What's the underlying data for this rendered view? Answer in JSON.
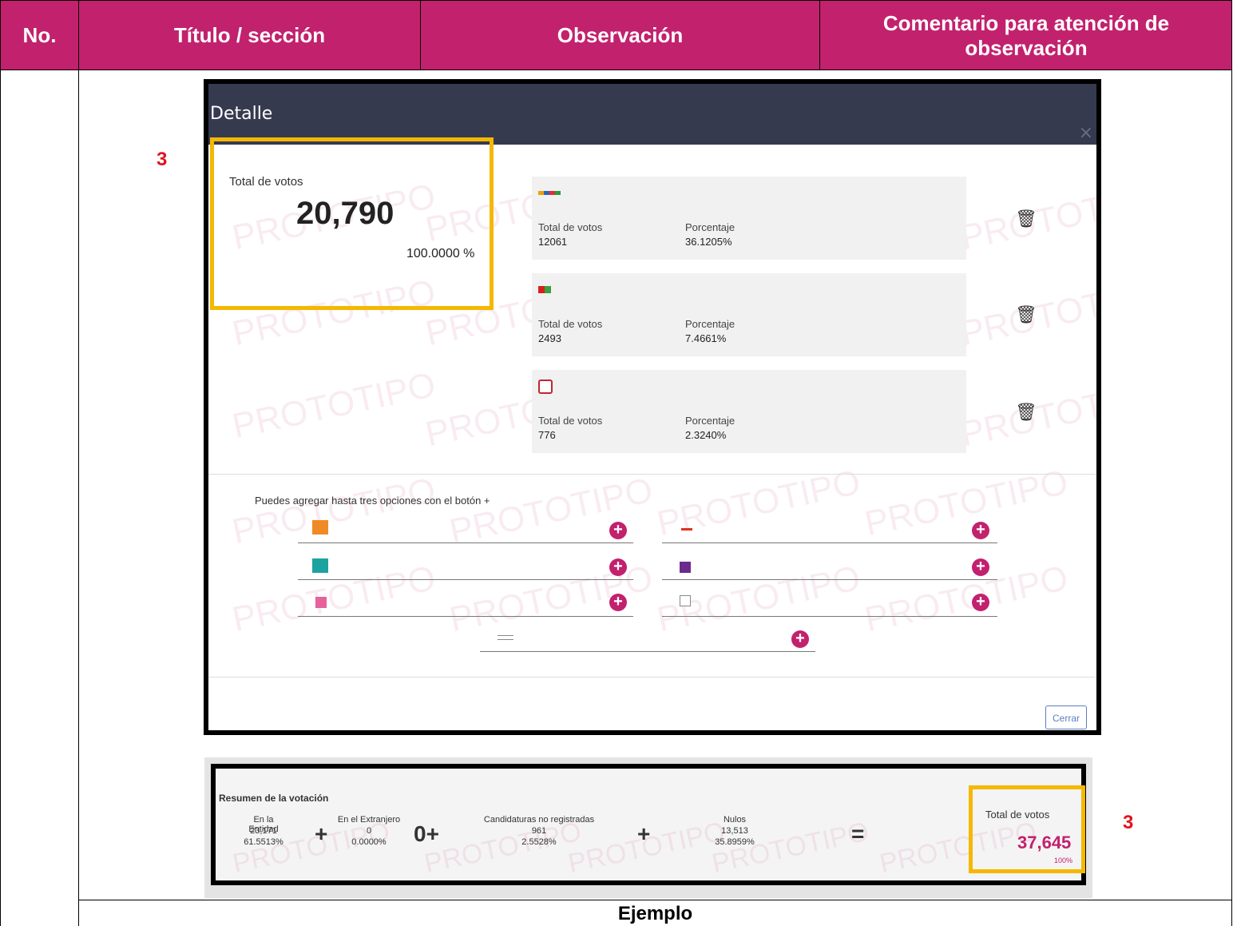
{
  "header": {
    "col_no": "No.",
    "col_titulo": "Título / sección",
    "col_observacion": "Observación",
    "col_comentario": "Comentario para atención de observación"
  },
  "annotations": {
    "marker_1": "3",
    "marker_2": "3"
  },
  "modal": {
    "title": "Detalle",
    "close": "×",
    "total_label": "Total de votos",
    "total_value": "20,790",
    "total_percent": "100.0000 %",
    "cards": [
      {
        "votes_label": "Total de votos",
        "votes": "12061",
        "pct_label": "Porcentaje",
        "pct": "36.1205%"
      },
      {
        "votes_label": "Total de votos",
        "votes": "2493",
        "pct_label": "Porcentaje",
        "pct": "7.4661%"
      },
      {
        "votes_label": "Total de votos",
        "votes": "776",
        "pct_label": "Porcentaje",
        "pct": "2.3240%"
      }
    ],
    "add_hint": "Puedes agregar hasta tres opciones con el botón +",
    "close_button": "Cerrar",
    "watermark": "PROTOTIPO",
    "icons": {
      "trash": "trash-icon",
      "plus": "plus-circle-icon"
    },
    "colors": {
      "accent": "#c2216e",
      "titlebar": "#363a4f",
      "highlight": "#f5b800"
    }
  },
  "summary": {
    "title": "Resumen de la votación",
    "entidad_label": "En la Entidad",
    "entidad_value": "23,171",
    "entidad_pct": "61.5513%",
    "extranjero_label": "En el Extranjero",
    "extranjero_value": "0",
    "extranjero_pct": "0.0000%",
    "no_reg_label": "Candidaturas no registradas",
    "no_reg_value": "961",
    "no_reg_pct": "2.5528%",
    "nulos_label": "Nulos",
    "nulos_value": "13,513",
    "nulos_pct": "35.8959%",
    "op_plus": "+",
    "op_zero_plus": "0+",
    "op_equals": "=",
    "total_label": "Total de votos",
    "total_value": "37,645",
    "total_pct": "100%"
  },
  "caption": "Ejemplo"
}
